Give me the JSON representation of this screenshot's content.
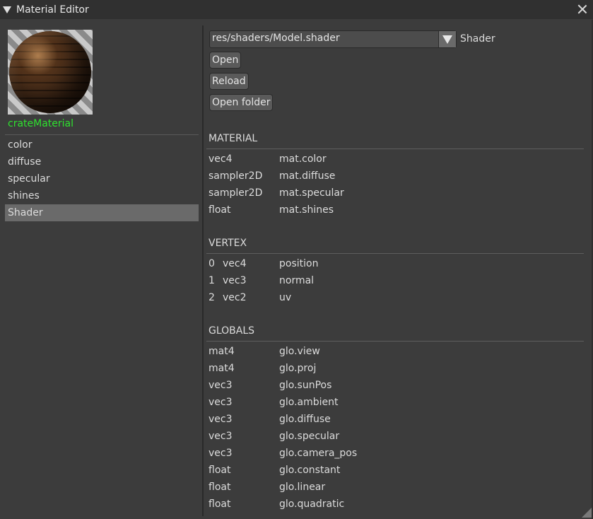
{
  "window": {
    "title": "Material Editor"
  },
  "left": {
    "material_name": "crateMaterial",
    "material_name_color": "#2ee22e",
    "properties": [
      {
        "label": "color"
      },
      {
        "label": "diffuse"
      },
      {
        "label": "specular"
      },
      {
        "label": "shines"
      },
      {
        "label": "Shader",
        "selected": true
      }
    ]
  },
  "shader": {
    "path": "res/shaders/Model.shader",
    "label": "Shader",
    "open_label": "Open",
    "reload_label": "Reload",
    "open_folder_label": "Open folder"
  },
  "material_section": {
    "title": "MATERIAL",
    "rows": [
      {
        "type": "vec4",
        "name": "mat.color"
      },
      {
        "type": "sampler2D",
        "name": "mat.diffuse"
      },
      {
        "type": "sampler2D",
        "name": "mat.specular"
      },
      {
        "type": "float",
        "name": "mat.shines"
      }
    ]
  },
  "vertex_section": {
    "title": "VERTEX",
    "rows": [
      {
        "location": "0",
        "type": "vec4",
        "name": "position"
      },
      {
        "location": "1",
        "type": "vec3",
        "name": "normal"
      },
      {
        "location": "2",
        "type": "vec2",
        "name": "uv"
      }
    ]
  },
  "globals_section": {
    "title": "GLOBALS",
    "rows": [
      {
        "type": "mat4",
        "name": "glo.view"
      },
      {
        "type": "mat4",
        "name": "glo.proj"
      },
      {
        "type": "vec3",
        "name": "glo.sunPos"
      },
      {
        "type": "vec3",
        "name": "glo.ambient"
      },
      {
        "type": "vec3",
        "name": "glo.diffuse"
      },
      {
        "type": "vec3",
        "name": "glo.specular"
      },
      {
        "type": "vec3",
        "name": "glo.camera_pos"
      },
      {
        "type": "float",
        "name": "glo.constant"
      },
      {
        "type": "float",
        "name": "glo.linear"
      },
      {
        "type": "float",
        "name": "glo.quadratic"
      }
    ]
  }
}
